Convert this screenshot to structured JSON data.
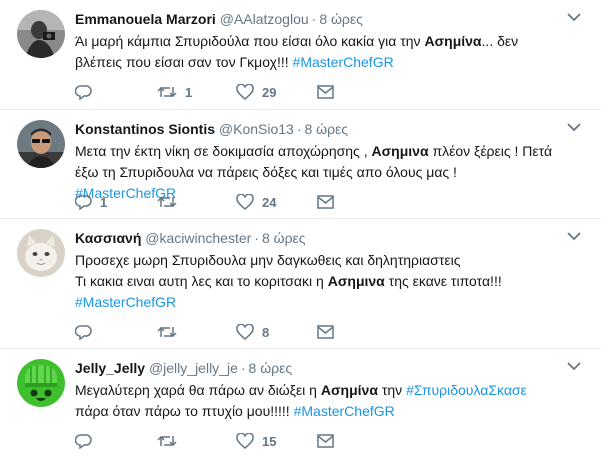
{
  "tweets": [
    {
      "fullname": "Emmanouela Marzori",
      "handle": "@AAlatzoglou",
      "time": "8 ώρες",
      "text_lines": [
        [
          {
            "t": "Άι μαρή κάμπια Σπυριδούλα που είσαι όλο κακία για την "
          },
          {
            "b": "Ασημίνα"
          },
          {
            "t": "... δεν"
          }
        ],
        [
          {
            "t": "βλέπεις που είσαι σαν τον Γκμοχ!!! "
          },
          {
            "h": "#MasterChefGR"
          }
        ]
      ],
      "replies": "",
      "retweets": "1",
      "likes": "29",
      "avatar": "person-with-camera"
    },
    {
      "fullname": "Konstantinos Siontis",
      "handle": "@KonSio13",
      "time": "8 ώρες",
      "text_lines": [
        [
          {
            "t": "Μετα την έκτη νίκη σε δοκιμασία αποχώρησης , "
          },
          {
            "b": "Ασημινα"
          },
          {
            "t": " πλέον ξέρεις ! Πετά"
          }
        ],
        [
          {
            "t": "έξω τη Σπυριδουλα να πάρεις δόξες και τιμές απο όλους μας ! "
          },
          {
            "h": "#MasterChefGR"
          }
        ]
      ],
      "replies": "1",
      "retweets": "",
      "likes": "24",
      "avatar": "man-with-sunglasses"
    },
    {
      "fullname": "Κασσιανή",
      "handle": "@kaciwinchester",
      "time": "8 ώρες",
      "text_lines": [
        [
          {
            "t": "Προσεχε μωρη Σπυριδουλα μην δαγκωθεις και δηλητηριαστεις"
          }
        ],
        [
          {
            "t": "Τι κακια ειναι αυτη λες και το κοριτσακι η "
          },
          {
            "b": "Ασημινα"
          },
          {
            "t": " της εκανε τιποτα!!!"
          }
        ],
        [
          {
            "h": "#MasterChefGR"
          }
        ]
      ],
      "replies": "",
      "retweets": "",
      "likes": "8",
      "avatar": "white-cat"
    },
    {
      "fullname": "Jelly_Jelly",
      "handle": "@jelly_jelly_je",
      "time": "8 ώρες",
      "text_lines": [
        [
          {
            "t": "Μεγαλύτερη χαρά θα πάρω αν διώξει η "
          },
          {
            "b": "Ασημίνα"
          },
          {
            "t": " την "
          },
          {
            "h": "#ΣπυριδουλαΣκασε"
          }
        ],
        [
          {
            "t": "πάρα όταν πάρω το πτυχίο μου!!!!!  "
          },
          {
            "h": "#MasterChefGR"
          }
        ]
      ],
      "replies": "",
      "retweets": "",
      "likes": "15",
      "avatar": "green-jelly"
    }
  ],
  "colors": {
    "text": "#14171a",
    "muted": "#657786",
    "hashtag": "#1b95e0",
    "divider": "#e6ecf0",
    "jelly": "#3fbf2e"
  }
}
